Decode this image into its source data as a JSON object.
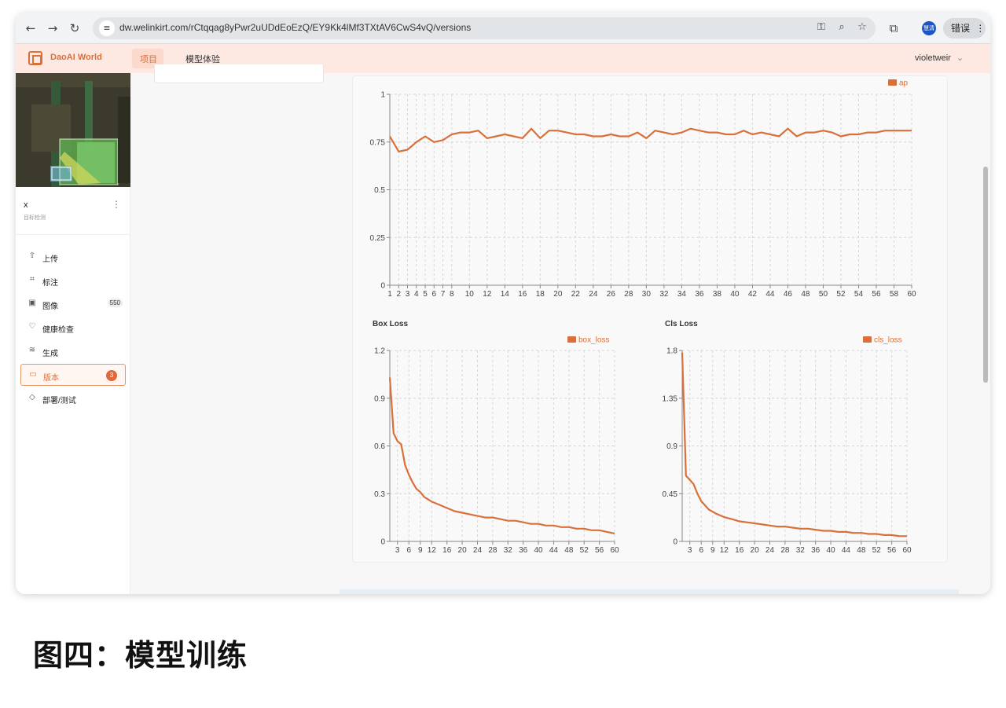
{
  "browser": {
    "url": "dw.welinkirt.com/rCtqqag8yPwr2uUDdEoEzQ/EY9Kk4lMf3TXtAV6CwS4vQ/versions",
    "profile_label": "慧清",
    "error_button": "错误"
  },
  "header": {
    "logo_text": "DaoAI World",
    "nav": [
      "项目",
      "模型体验"
    ],
    "user": "violetweir"
  },
  "sidebar": {
    "project_name": "x",
    "project_type": "目标检测",
    "items": [
      {
        "label": "上传",
        "icon": "upload-icon"
      },
      {
        "label": "标注",
        "icon": "annotate-icon"
      },
      {
        "label": "图像",
        "icon": "image-icon",
        "badge": "550"
      },
      {
        "label": "健康检查",
        "icon": "health-icon"
      },
      {
        "label": "生成",
        "icon": "generate-icon"
      },
      {
        "label": "版本",
        "icon": "folder-icon",
        "badge": "3"
      },
      {
        "label": "部署/测试",
        "icon": "tag-icon"
      }
    ]
  },
  "chart_data": [
    {
      "type": "line",
      "title": "",
      "series": [
        {
          "name": "ap",
          "color": "#d9703a"
        }
      ],
      "x": [
        1,
        2,
        3,
        4,
        5,
        6,
        7,
        8,
        9,
        10,
        11,
        12,
        13,
        14,
        15,
        16,
        17,
        18,
        19,
        20,
        21,
        22,
        23,
        24,
        25,
        26,
        27,
        28,
        29,
        30,
        31,
        32,
        33,
        34,
        35,
        36,
        37,
        38,
        39,
        40,
        41,
        42,
        43,
        44,
        45,
        46,
        47,
        48,
        49,
        50,
        51,
        52,
        53,
        54,
        55,
        56,
        57,
        58,
        59,
        60
      ],
      "values": [
        0.78,
        0.7,
        0.71,
        0.75,
        0.78,
        0.75,
        0.76,
        0.79,
        0.8,
        0.8,
        0.81,
        0.77,
        0.78,
        0.79,
        0.78,
        0.77,
        0.82,
        0.77,
        0.81,
        0.81,
        0.8,
        0.79,
        0.79,
        0.78,
        0.78,
        0.79,
        0.78,
        0.78,
        0.8,
        0.77,
        0.81,
        0.8,
        0.79,
        0.8,
        0.82,
        0.81,
        0.8,
        0.8,
        0.79,
        0.79,
        0.81,
        0.79,
        0.8,
        0.79,
        0.78,
        0.82,
        0.78,
        0.8,
        0.8,
        0.81,
        0.8,
        0.78,
        0.79,
        0.79,
        0.8,
        0.8,
        0.81,
        0.81,
        0.81,
        0.81
      ],
      "xticks": [
        1,
        2,
        3,
        4,
        5,
        6,
        7,
        8,
        10,
        12,
        14,
        16,
        18,
        20,
        22,
        24,
        26,
        28,
        30,
        32,
        34,
        36,
        38,
        40,
        42,
        44,
        46,
        48,
        50,
        52,
        54,
        56,
        58,
        60
      ],
      "yticks": [
        "0",
        "0.25",
        "0.5",
        "0.75",
        "1"
      ],
      "ylim": [
        0,
        1
      ],
      "xlim": [
        1,
        60
      ],
      "grid": true,
      "legend": "top-right"
    },
    {
      "type": "line",
      "title": "Box Loss",
      "series": [
        {
          "name": "box_loss",
          "color": "#d9703a"
        }
      ],
      "x": [
        1,
        2,
        3,
        4,
        5,
        6,
        7,
        8,
        9,
        10,
        12,
        14,
        16,
        18,
        20,
        22,
        24,
        26,
        28,
        30,
        32,
        34,
        36,
        38,
        40,
        42,
        44,
        46,
        48,
        50,
        52,
        54,
        56,
        58,
        60
      ],
      "values": [
        1.03,
        0.68,
        0.63,
        0.61,
        0.48,
        0.42,
        0.37,
        0.33,
        0.31,
        0.28,
        0.25,
        0.23,
        0.21,
        0.19,
        0.18,
        0.17,
        0.16,
        0.15,
        0.15,
        0.14,
        0.13,
        0.13,
        0.12,
        0.11,
        0.11,
        0.1,
        0.1,
        0.09,
        0.09,
        0.08,
        0.08,
        0.07,
        0.07,
        0.06,
        0.05
      ],
      "xticks": [
        3,
        6,
        9,
        12,
        16,
        20,
        24,
        28,
        32,
        36,
        40,
        44,
        48,
        52,
        56,
        60
      ],
      "yticks": [
        "0",
        "0.3",
        "0.6",
        "0.9",
        "1.2"
      ],
      "ylim": [
        0,
        1.2
      ],
      "xlim": [
        1,
        60
      ],
      "grid": true,
      "legend": "top-right"
    },
    {
      "type": "line",
      "title": "Cls Loss",
      "series": [
        {
          "name": "cls_loss",
          "color": "#d9703a"
        }
      ],
      "x": [
        1,
        2,
        3,
        4,
        5,
        6,
        7,
        8,
        9,
        10,
        12,
        14,
        16,
        18,
        20,
        22,
        24,
        26,
        28,
        30,
        32,
        34,
        36,
        38,
        40,
        42,
        44,
        46,
        48,
        50,
        52,
        54,
        56,
        58,
        60
      ],
      "values": [
        1.78,
        0.62,
        0.58,
        0.54,
        0.45,
        0.38,
        0.34,
        0.3,
        0.28,
        0.26,
        0.23,
        0.21,
        0.19,
        0.18,
        0.17,
        0.16,
        0.15,
        0.14,
        0.14,
        0.13,
        0.12,
        0.12,
        0.11,
        0.1,
        0.1,
        0.09,
        0.09,
        0.08,
        0.08,
        0.07,
        0.07,
        0.06,
        0.06,
        0.05,
        0.05
      ],
      "xticks": [
        3,
        6,
        9,
        12,
        16,
        20,
        24,
        28,
        32,
        36,
        40,
        44,
        48,
        52,
        56,
        60
      ],
      "yticks": [
        "0",
        "0.45",
        "0.9",
        "1.35",
        "1.8"
      ],
      "ylim": [
        0,
        1.8
      ],
      "xlim": [
        1,
        60
      ],
      "grid": true,
      "legend": "top-right"
    }
  ],
  "caption": "图四：模型训练"
}
